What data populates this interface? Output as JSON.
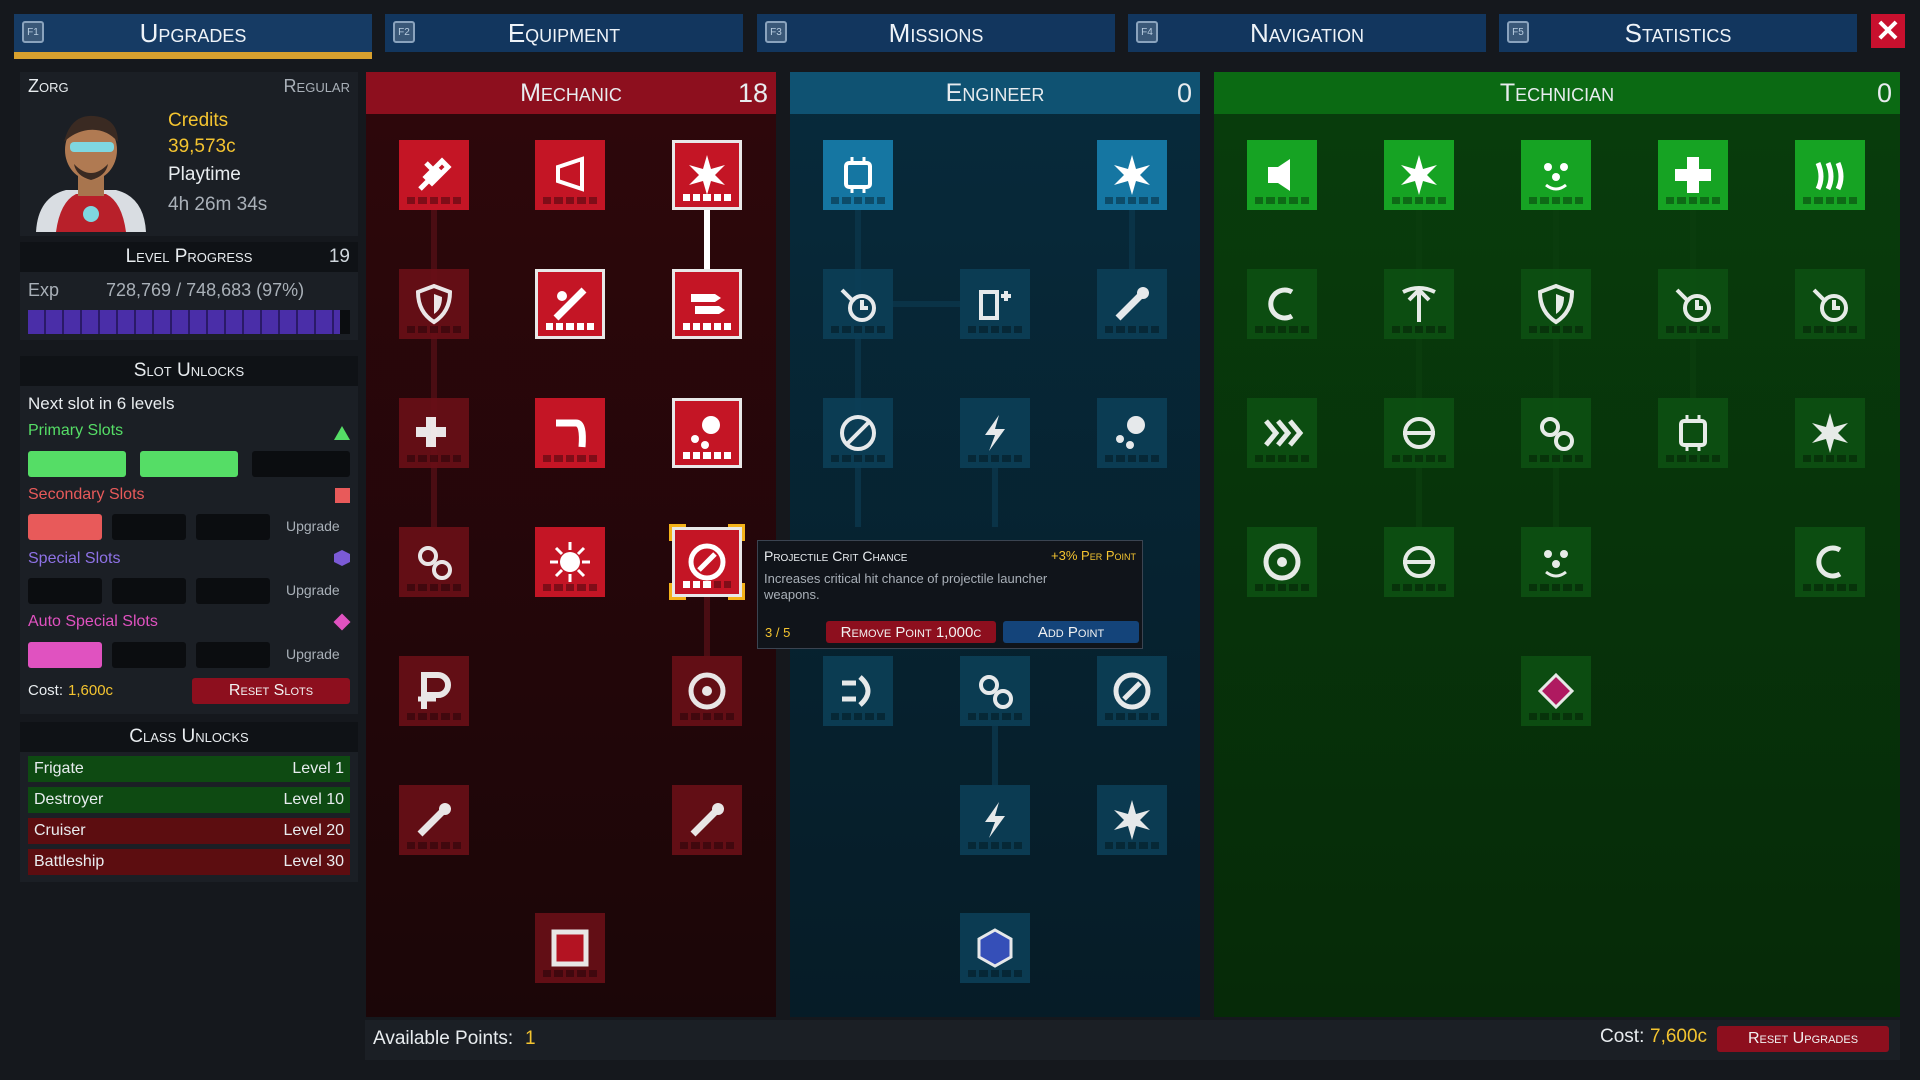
{
  "tabs": [
    {
      "key": "F1",
      "label": "Upgrades",
      "active": true
    },
    {
      "key": "F2",
      "label": "Equipment",
      "active": false
    },
    {
      "key": "F3",
      "label": "Missions",
      "active": false
    },
    {
      "key": "F4",
      "label": "Navigation",
      "active": false
    },
    {
      "key": "F5",
      "label": "Statistics",
      "active": false
    }
  ],
  "close_label": "✕",
  "player": {
    "name": "Zorg",
    "rank": "Regular",
    "credits_label": "Credits",
    "credits": "39,573c",
    "playtime_label": "Playtime",
    "playtime": "4h 26m 34s"
  },
  "level": {
    "title": "Level Progress",
    "level": "19",
    "exp_label": "Exp",
    "exp": "728,769 / 748,683 (97%)",
    "progress": 0.97,
    "color": "#4a2ea8"
  },
  "slots": {
    "title": "Slot Unlocks",
    "next": "Next slot in 6 levels",
    "primary": {
      "label": "Primary Slots",
      "color": "#55dd66"
    },
    "secondary": {
      "label": "Secondary Slots",
      "color": "#e85a5a"
    },
    "special": {
      "label": "Special Slots",
      "color": "#7b5ad6"
    },
    "auto": {
      "label": "Auto Special Slots",
      "color": "#e052c0"
    },
    "upgrade_label": "Upgrade",
    "cost_label": "Cost:",
    "cost": "1,600c",
    "reset": "Reset Slots"
  },
  "classes": {
    "title": "Class Unlocks",
    "rows": [
      {
        "name": "Frigate",
        "level": "Level 1"
      },
      {
        "name": "Destroyer",
        "level": "Level 10"
      },
      {
        "name": "Cruiser",
        "level": "Level 20"
      },
      {
        "name": "Battleship",
        "level": "Level 30"
      }
    ]
  },
  "trees": [
    {
      "name": "Mechanic",
      "points": "18",
      "color": "#b8101e"
    },
    {
      "name": "Engineer",
      "points": "0",
      "color": "#0f5d80"
    },
    {
      "name": "Technician",
      "points": "0",
      "color": "#0c7a16"
    }
  ],
  "tooltip": {
    "title": "Projectile Crit Chance",
    "bonus": "+3% Per Point",
    "desc": "Increases critical hit chance of projectile launcher weapons.",
    "progress": "3 / 5",
    "remove": "Remove Point 1,000c",
    "add": "Add Point"
  },
  "footer": {
    "points_label": "Available Points:",
    "points": "1",
    "cost_label": "Cost:",
    "cost": "7,600c",
    "reset": "Reset Upgrades"
  }
}
